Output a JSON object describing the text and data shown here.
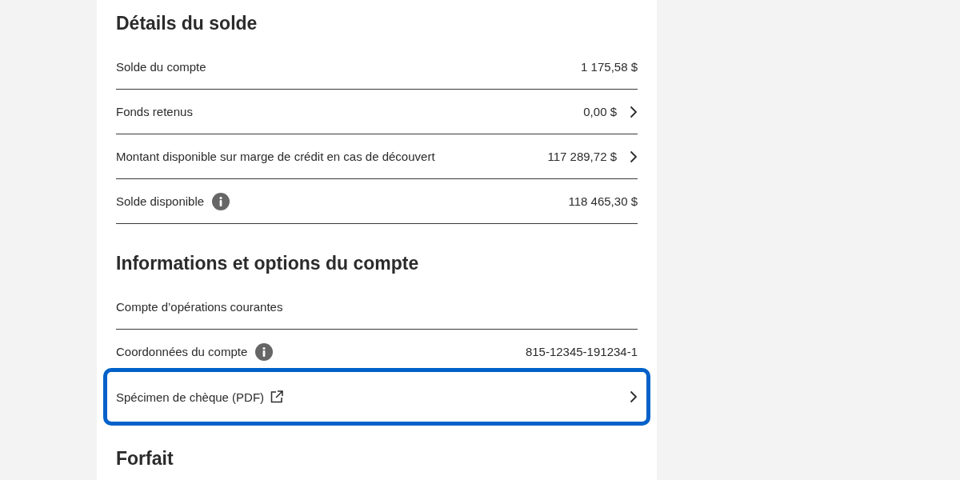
{
  "sections": [
    {
      "title": "Détails du solde",
      "rows": [
        {
          "label": "Solde du compte",
          "value": "1 175,58 $",
          "info": false,
          "chevron": false,
          "external": false,
          "divider": true,
          "focused": false
        },
        {
          "label": "Fonds retenus",
          "value": "0,00 $",
          "info": false,
          "chevron": true,
          "external": false,
          "divider": true,
          "focused": false
        },
        {
          "label": "Montant disponible sur marge de crédit en cas de découvert",
          "value": "117 289,72 $",
          "info": false,
          "chevron": true,
          "external": false,
          "divider": true,
          "focused": false
        },
        {
          "label": "Solde disponible",
          "value": "118 465,30 $",
          "info": true,
          "chevron": false,
          "external": false,
          "divider": true,
          "focused": false
        }
      ]
    },
    {
      "title": "Informations et options du compte",
      "rows": [
        {
          "label": "Compte d’opérations courantes",
          "info": false,
          "chevron": false,
          "external": false,
          "divider": true,
          "focused": false
        },
        {
          "label": "Coordonnées du compte",
          "value": "815-12345-191234-1",
          "info": true,
          "chevron": false,
          "external": false,
          "divider": false,
          "focused": false
        },
        {
          "label": "Spécimen de chèque (PDF)",
          "info": false,
          "chevron": true,
          "external": true,
          "divider": false,
          "focused": true
        }
      ]
    },
    {
      "title": "Forfait"
    }
  ]
}
